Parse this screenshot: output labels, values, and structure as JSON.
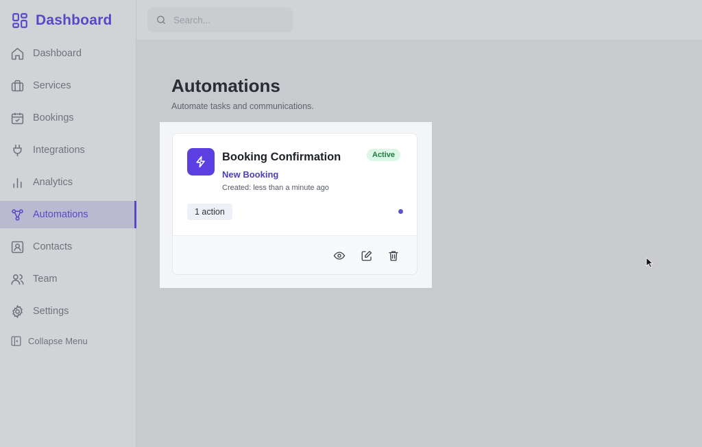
{
  "brand": {
    "title": "Dashboard",
    "accent": "#5a47c8"
  },
  "search": {
    "placeholder": "Search..."
  },
  "sidebar": {
    "items": [
      {
        "label": "Dashboard",
        "icon": "home-icon",
        "active": false
      },
      {
        "label": "Services",
        "icon": "briefcase-icon",
        "active": false
      },
      {
        "label": "Bookings",
        "icon": "calendar-check-icon",
        "active": false
      },
      {
        "label": "Integrations",
        "icon": "plug-icon",
        "active": false
      },
      {
        "label": "Analytics",
        "icon": "bar-chart-icon",
        "active": false
      },
      {
        "label": "Automations",
        "icon": "workflow-icon",
        "active": true
      },
      {
        "label": "Contacts",
        "icon": "contact-card-icon",
        "active": false
      },
      {
        "label": "Team",
        "icon": "users-icon",
        "active": false
      },
      {
        "label": "Settings",
        "icon": "gear-icon",
        "active": false
      }
    ],
    "collapse_label": "Collapse Menu"
  },
  "page": {
    "title": "Automations",
    "subtitle": "Automate tasks and communications."
  },
  "automation_card": {
    "title": "Booking Confirmation",
    "trigger": "New Booking",
    "created": "Created: less than a minute ago",
    "status": "Active",
    "actions_count": "1 action",
    "icon": "lightning-bolt-icon",
    "footer_icons": [
      "eye-icon",
      "edit-icon",
      "trash-icon"
    ],
    "status_color": "#1e7a44",
    "icon_bg": "#5b3fe0"
  }
}
